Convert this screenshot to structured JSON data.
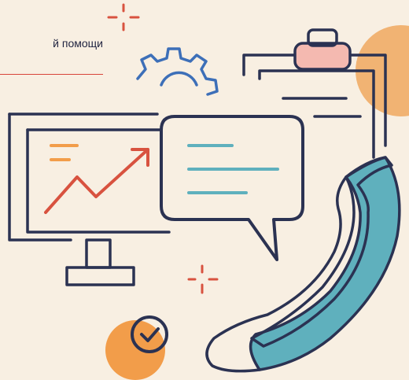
{
  "header": {
    "caption": "й помощи"
  },
  "colors": {
    "background": "#f8efe2",
    "outline": "#2b3252",
    "accent_orange": "#f1b373",
    "accent_red": "#d8523f",
    "accent_teal": "#5fb0bd",
    "accent_blue": "#3d6fb8",
    "accent_pink": "#f4b9b0",
    "accent_orange_bright": "#f29d4a"
  },
  "icons": [
    "monitor-chart-icon",
    "gear-icon",
    "clipboard-icon",
    "chat-bubble-icon",
    "phone-handset-icon",
    "check-circle-icon",
    "sparkle-icon"
  ]
}
